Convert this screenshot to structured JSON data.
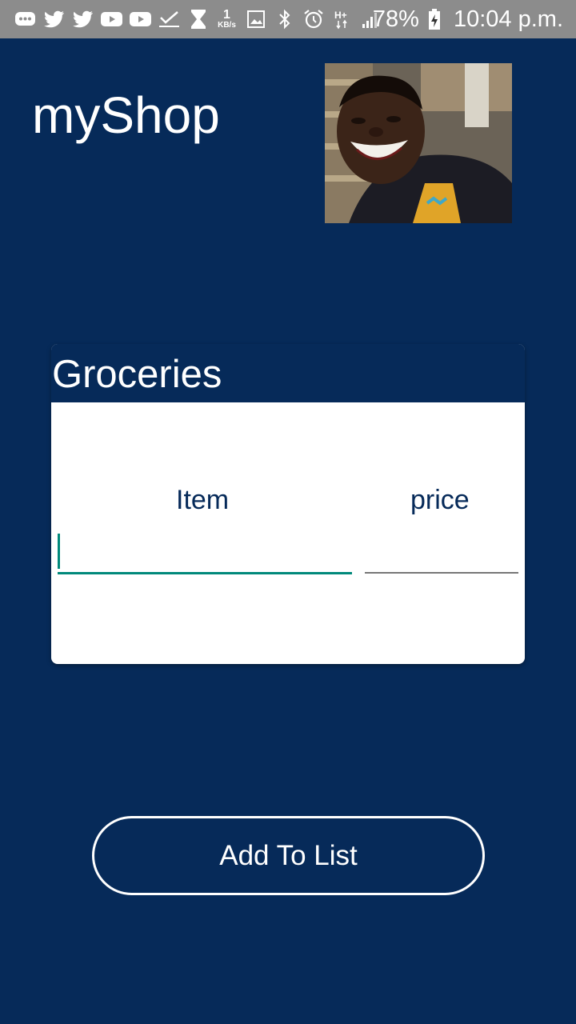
{
  "status_bar": {
    "icons": [
      "messages-icon",
      "twitter-icon",
      "twitter-icon",
      "youtube-icon",
      "youtube-icon",
      "check-icon",
      "hourglass-icon",
      "data-speed-icon",
      "image-icon",
      "bluetooth-icon",
      "alarm-icon",
      "network-hplus-icon",
      "signal-icon"
    ],
    "data_speed_value": "1",
    "data_speed_unit": "KB/s",
    "network_type": "H+",
    "battery": "78%",
    "time": "10:04 p.m."
  },
  "header": {
    "app_title": "myShop"
  },
  "card": {
    "title": "Groceries",
    "item_label": "Item",
    "price_label": "price",
    "item_value": "",
    "price_value": ""
  },
  "actions": {
    "add_label": "Add To List"
  },
  "colors": {
    "background": "#062a59",
    "accent": "#00897b",
    "card": "#ffffff",
    "status_bar": "#8c8c8c"
  }
}
